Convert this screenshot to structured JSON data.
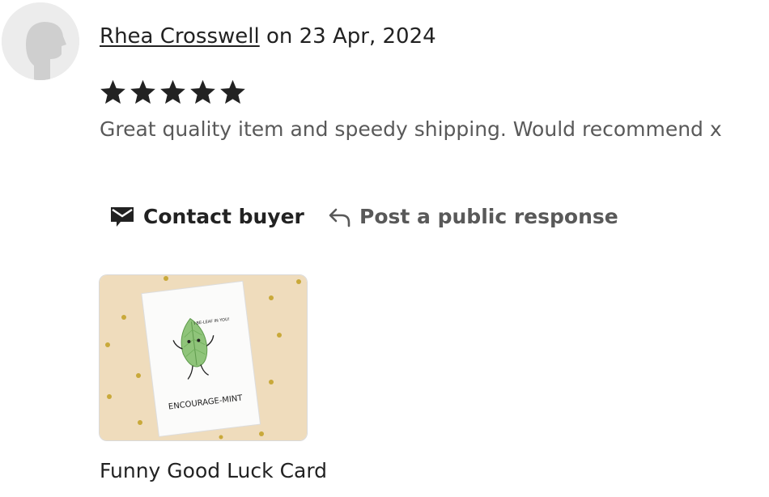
{
  "review": {
    "reviewer_name": "Rhea Crosswell",
    "date_text": "on 23 Apr, 2024",
    "rating": 5,
    "rating_max": 5,
    "text": "Great quality item and speedy shipping. Would recommend x"
  },
  "actions": {
    "contact_label": "Contact buyer",
    "contact_icon": "envelope-icon",
    "respond_label": "Post a public response",
    "respond_icon": "reply-arrow-icon"
  },
  "product": {
    "title": "Funny Good Luck Card",
    "card_text_top": "I BE-LEAF IN YOU!",
    "card_text_bottom": "ENCOURAGE-MINT"
  },
  "colors": {
    "text": "#222222",
    "muted": "#595959",
    "star": "#222222",
    "thumb_bg": "#efdcbc",
    "dots": "#c9a93a",
    "leaf": "#8fc47a",
    "avatar_bg": "#ececec"
  }
}
